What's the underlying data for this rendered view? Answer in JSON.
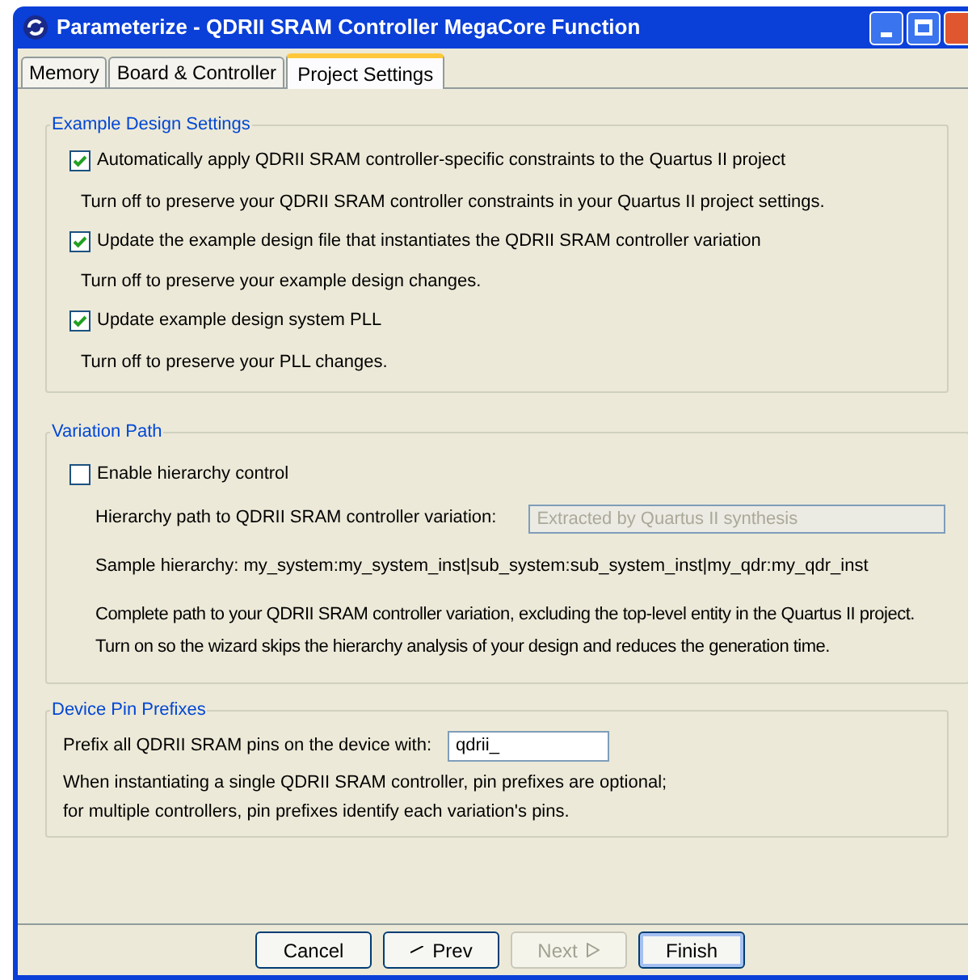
{
  "window": {
    "title": "Parameterize - QDRII SRAM Controller MegaCore Function"
  },
  "tabs": [
    {
      "label": "Memory",
      "selected": false
    },
    {
      "label": "Board & Controller",
      "selected": false
    },
    {
      "label": "Project Settings",
      "selected": true
    }
  ],
  "example_design_settings": {
    "title": "Example Design Settings",
    "options": [
      {
        "label": "Automatically apply QDRII SRAM controller-specific constraints to the Quartus II project",
        "checked": true,
        "hint": "Turn off to preserve your QDRII SRAM controller constraints in your Quartus II project settings."
      },
      {
        "label": "Update the example design file that instantiates the QDRII SRAM controller variation",
        "checked": true,
        "hint": "Turn off to preserve your example design changes."
      },
      {
        "label": "Update example design system PLL",
        "checked": true,
        "hint": "Turn off to preserve your PLL changes."
      }
    ]
  },
  "variation_path": {
    "title": "Variation Path",
    "enable": {
      "label": "Enable hierarchy control",
      "checked": false
    },
    "path_label": "Hierarchy path to QDRII SRAM controller variation:",
    "path_field": {
      "placeholder": "Extracted by Quartus II synthesis",
      "disabled": true
    },
    "sample": "Sample hierarchy: my_system:my_system_inst|sub_system:sub_system_inst|my_qdr:my_qdr_inst",
    "description": "Complete path to your QDRII SRAM controller variation, excluding the top-level entity in the Quartus II project. Turn on so the wizard skips the hierarchy analysis of your design and reduces the generation time."
  },
  "device_pin_prefixes": {
    "title": "Device Pin Prefixes",
    "prefix_label": "Prefix all QDRII SRAM pins on the device with:",
    "prefix_value": "qdrii_",
    "notes": [
      "When instantiating a single QDRII SRAM controller, pin prefixes are optional;",
      "for multiple controllers, pin prefixes identify each variation's pins."
    ]
  },
  "buttons": [
    {
      "label": "Cancel",
      "kind": "plain",
      "disabled": false,
      "default": false
    },
    {
      "label": "Prev",
      "kind": "prev",
      "disabled": false,
      "default": false
    },
    {
      "label": "Next",
      "kind": "next",
      "disabled": true,
      "default": false
    },
    {
      "label": "Finish",
      "kind": "plain",
      "disabled": false,
      "default": true
    }
  ]
}
